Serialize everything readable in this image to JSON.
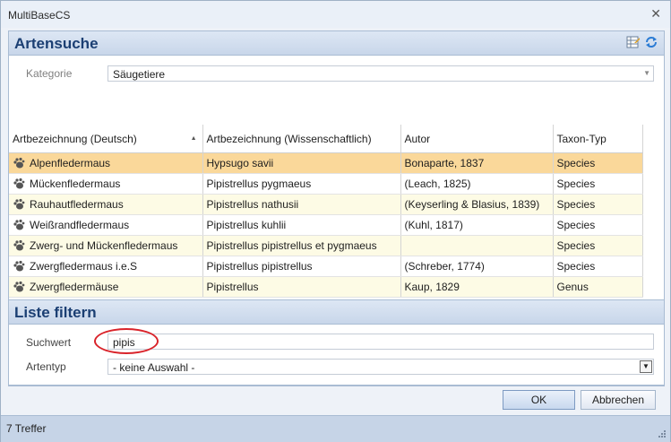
{
  "window": {
    "title": "MultiBaseCS"
  },
  "search_panel": {
    "title": "Artensuche",
    "category_label": "Kategorie",
    "category_value": "Säugetiere"
  },
  "grid": {
    "columns": [
      "Artbezeichnung (Deutsch)",
      "Artbezeichnung (Wissenschaftlich)",
      "Autor",
      "Taxon-Typ"
    ],
    "rows": [
      {
        "de": "Alpenfledermaus",
        "sci": "Hypsugo savii",
        "author": "Bonaparte, 1837",
        "type": "Species"
      },
      {
        "de": "Mückenfledermaus",
        "sci": "Pipistrellus pygmaeus",
        "author": "(Leach, 1825)",
        "type": "Species"
      },
      {
        "de": "Rauhautfledermaus",
        "sci": "Pipistrellus nathusii",
        "author": "(Keyserling & Blasius, 1839)",
        "type": "Species"
      },
      {
        "de": "Weißrandfledermaus",
        "sci": "Pipistrellus kuhlii",
        "author": "(Kuhl, 1817)",
        "type": "Species"
      },
      {
        "de": "Zwerg- und Mückenfledermaus",
        "sci": "Pipistrellus pipistrellus et pygmaeus",
        "author": "",
        "type": "Species"
      },
      {
        "de": "Zwergfledermaus i.e.S",
        "sci": "Pipistrellus pipistrellus",
        "author": "(Schreber, 1774)",
        "type": "Species"
      },
      {
        "de": "Zwergfledermäuse",
        "sci": "Pipistrellus",
        "author": "Kaup, 1829",
        "type": "Genus"
      }
    ]
  },
  "filter_panel": {
    "title": "Liste filtern",
    "search_label": "Suchwert",
    "search_value": "pipis",
    "type_label": "Artentyp",
    "type_value": "- keine Auswahl -"
  },
  "buttons": {
    "ok": "OK",
    "cancel": "Abbrechen"
  },
  "status": {
    "text": "7 Treffer"
  },
  "colors": {
    "header_text": "#1b3f73",
    "selected_row": "#fad89a",
    "alt_row": "#fdfbe5",
    "highlight_circle": "#d9232a"
  }
}
